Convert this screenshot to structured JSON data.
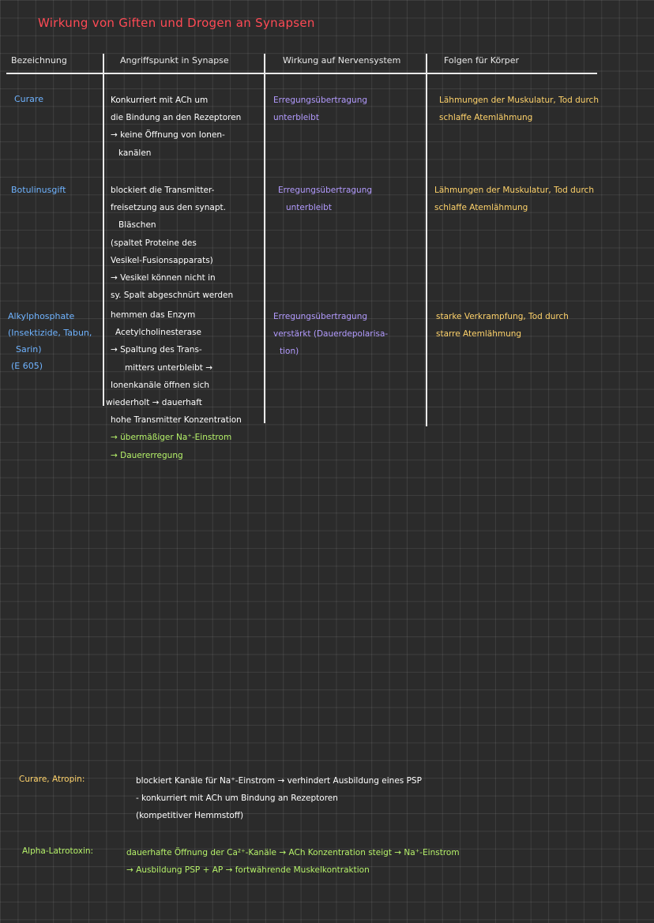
{
  "title": "Wirkung von Giften und Drogen an Synapsen",
  "headers": {
    "name": "Bezeichnung",
    "attack": "Angriffspunkt in Synapse",
    "effect": "Wirkung auf Nervensystem",
    "consequence": "Folgen für Körper"
  },
  "rows": [
    {
      "name": [
        "Curare"
      ],
      "attack": [
        "Konkurriert mit ACh um",
        "die Bindung an den Rezeptoren",
        "→ keine Öffnung von Ionen-",
        "kanälen"
      ],
      "effect": [
        "Erregungsübertragung",
        "unterbleibt"
      ],
      "consequence": [
        "Lähmungen der Muskulatur, Tod durch",
        "schlaffe Atemlähmung"
      ]
    },
    {
      "name": [
        "Botulinusgift"
      ],
      "attack": [
        "blockiert die Transmitter-",
        "freisetzung aus den synapt.",
        "Bläschen",
        "(spaltet Proteine des",
        "Vesikel-Fusionsapparats)",
        "→ Vesikel können nicht in",
        "sy. Spalt abgeschnürt werden"
      ],
      "effect": [
        "Erregungsübertragung",
        "unterbleibt"
      ],
      "consequence": [
        "Lähmungen der Muskulatur, Tod durch",
        "schlaffe Atemlähmung"
      ]
    },
    {
      "name": [
        "Alkylphosphate",
        "(Insektizide, Tabun,",
        "Sarin)",
        "(E 605)"
      ],
      "attack": [
        "hemmen das Enzym",
        "Acetylcholinesterase",
        "→ Spaltung des Trans-",
        "mitters unterbleibt →",
        "Ionenkanäle öffnen sich",
        "wiederholt → dauerhaft",
        "hohe Transmitter Konzentration",
        "→ übermäßiger Na⁺-Einstrom",
        "→ Dauererregung"
      ],
      "effect": [
        "Erregungsübertragung",
        "verstärkt (Dauerdepolarisa-",
        "tion)"
      ],
      "consequence": [
        "starke Verkrampfung, Tod durch",
        "starre Atemlähmung"
      ]
    }
  ],
  "footnotes": {
    "curare_atropin": {
      "label": "Curare, Atropin:",
      "lines": [
        "blockiert Kanäle für Na⁺-Einstrom → verhindert Ausbildung eines PSP",
        "- konkurriert mit ACh um Bindung an Rezeptoren",
        "(kompetitiver Hemmstoff)"
      ]
    },
    "alpha_latrotoxin": {
      "label": "Alpha-Latrotoxin:",
      "lines": [
        "dauerhafte Öffnung der Ca²⁺-Kanäle → ACh Konzentration steigt → Na⁺-Einstrom",
        "→ Ausbildung PSP + AP → fortwährende Muskelkontraktion"
      ]
    }
  }
}
